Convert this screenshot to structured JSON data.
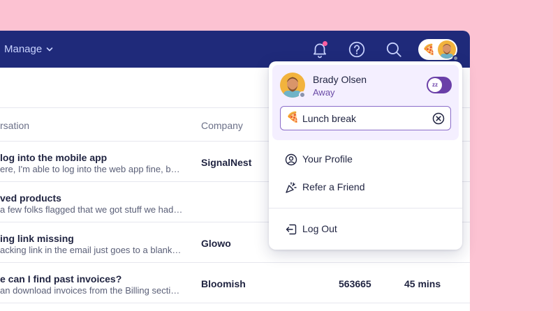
{
  "topbar": {
    "manage_label": "Manage",
    "icons": [
      "bell-icon",
      "help-icon",
      "search-icon"
    ],
    "avatar_status_emoji": "🍕"
  },
  "table": {
    "headers": [
      "rsation",
      "Company"
    ],
    "rows": [
      {
        "title": "log into the mobile app",
        "snippet": "ere, I'm able to log into the web app fine, but...",
        "company": "SignalNest",
        "number": "",
        "time": ""
      },
      {
        "title": "ved products",
        "snippet": "a few folks flagged that we got stuff we hadn't...",
        "company": "",
        "number": "",
        "time": ""
      },
      {
        "title": "ing link missing",
        "snippet": "acking link in the email just goes to a blank pa...",
        "company": "Glowo",
        "number": "",
        "time": ""
      },
      {
        "title": "e can I find past invoices?",
        "snippet": "an download invoices from the Billing section...",
        "company": "Bloomish",
        "number": "563665",
        "time": "45 mins"
      }
    ]
  },
  "dropdown": {
    "user_name": "Brady Olsen",
    "user_status": "Away",
    "toggle_label": "zz",
    "status_emoji": "🍕",
    "status_value": "Lunch break",
    "menu": {
      "profile": "Your Profile",
      "refer": "Refer a Friend",
      "logout": "Log Out"
    }
  },
  "colors": {
    "background": "#fcc2d2",
    "topbar": "#1f2a7a",
    "accent_purple": "#6a3fa8",
    "notification_dot": "#ff5ea0"
  }
}
